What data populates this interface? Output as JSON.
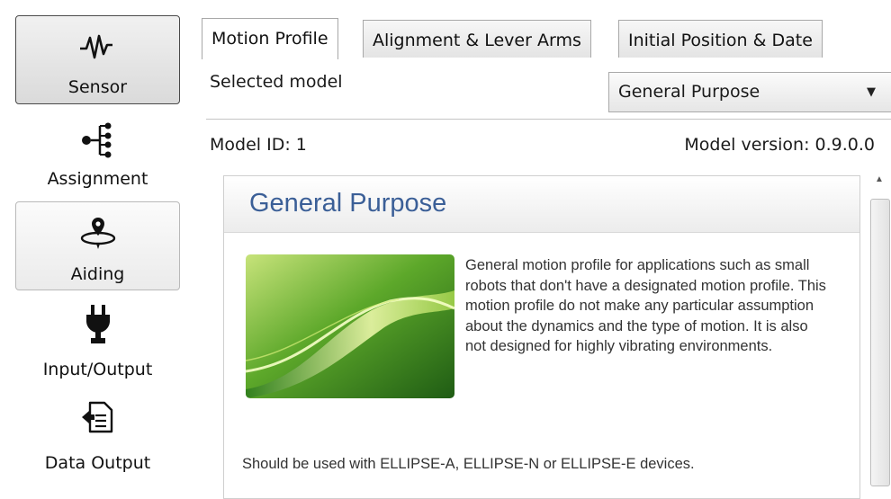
{
  "sidebar": {
    "items": [
      {
        "label": "Sensor",
        "icon": "waveform-icon",
        "selected": true
      },
      {
        "label": "Assignment",
        "icon": "hierarchy-icon",
        "selected": false
      },
      {
        "label": "Aiding",
        "icon": "location-orbit-icon",
        "selected": false
      },
      {
        "label": "Input/Output",
        "icon": "plug-icon",
        "selected": false
      },
      {
        "label": "Data Output",
        "icon": "document-export-icon",
        "selected": false
      }
    ]
  },
  "tabs": [
    {
      "label": "Motion Profile",
      "active": true
    },
    {
      "label": "Alignment & Lever Arms",
      "active": false
    },
    {
      "label": "Initial Position & Date",
      "active": false
    }
  ],
  "selected_model": {
    "label": "Selected model",
    "value": "General Purpose"
  },
  "model_info": {
    "id": "Model ID: 1",
    "version": "Model version: 0.9.0.0"
  },
  "profile": {
    "title": "General Purpose",
    "description": "General motion profile for applications such as small robots that don't have a designated motion profile. This motion profile do not make any particular assumption about the dynamics and the type of motion. It is also not designed for highly vibrating environments.",
    "note": "Should be used with ELLIPSE-A, ELLIPSE-N or ELLIPSE-E devices."
  },
  "colors": {
    "title": "#3b5f97",
    "accent_green": "#5fae2a"
  }
}
